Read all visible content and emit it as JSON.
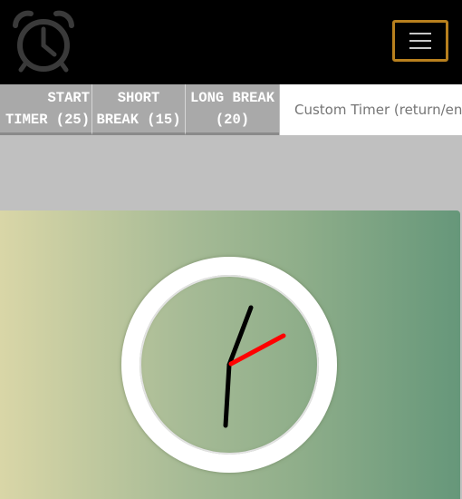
{
  "header": {
    "logo_icon": "alarm-clock-icon",
    "menu_icon": "hamburger-menu-icon",
    "menu_border_color": "#b8801e"
  },
  "timers": {
    "start_timer_label": "START\nTIMER (25)",
    "short_break_label": "SHORT\nBREAK (15)",
    "long_break_label": "LONG BREAK\n(20)",
    "custom_timer_placeholder": "Custom Timer (return/enter)"
  },
  "clock": {
    "hour_hand_color": "#000000",
    "second_hand_color": "#ff0000",
    "face_color": "#ffffff"
  }
}
